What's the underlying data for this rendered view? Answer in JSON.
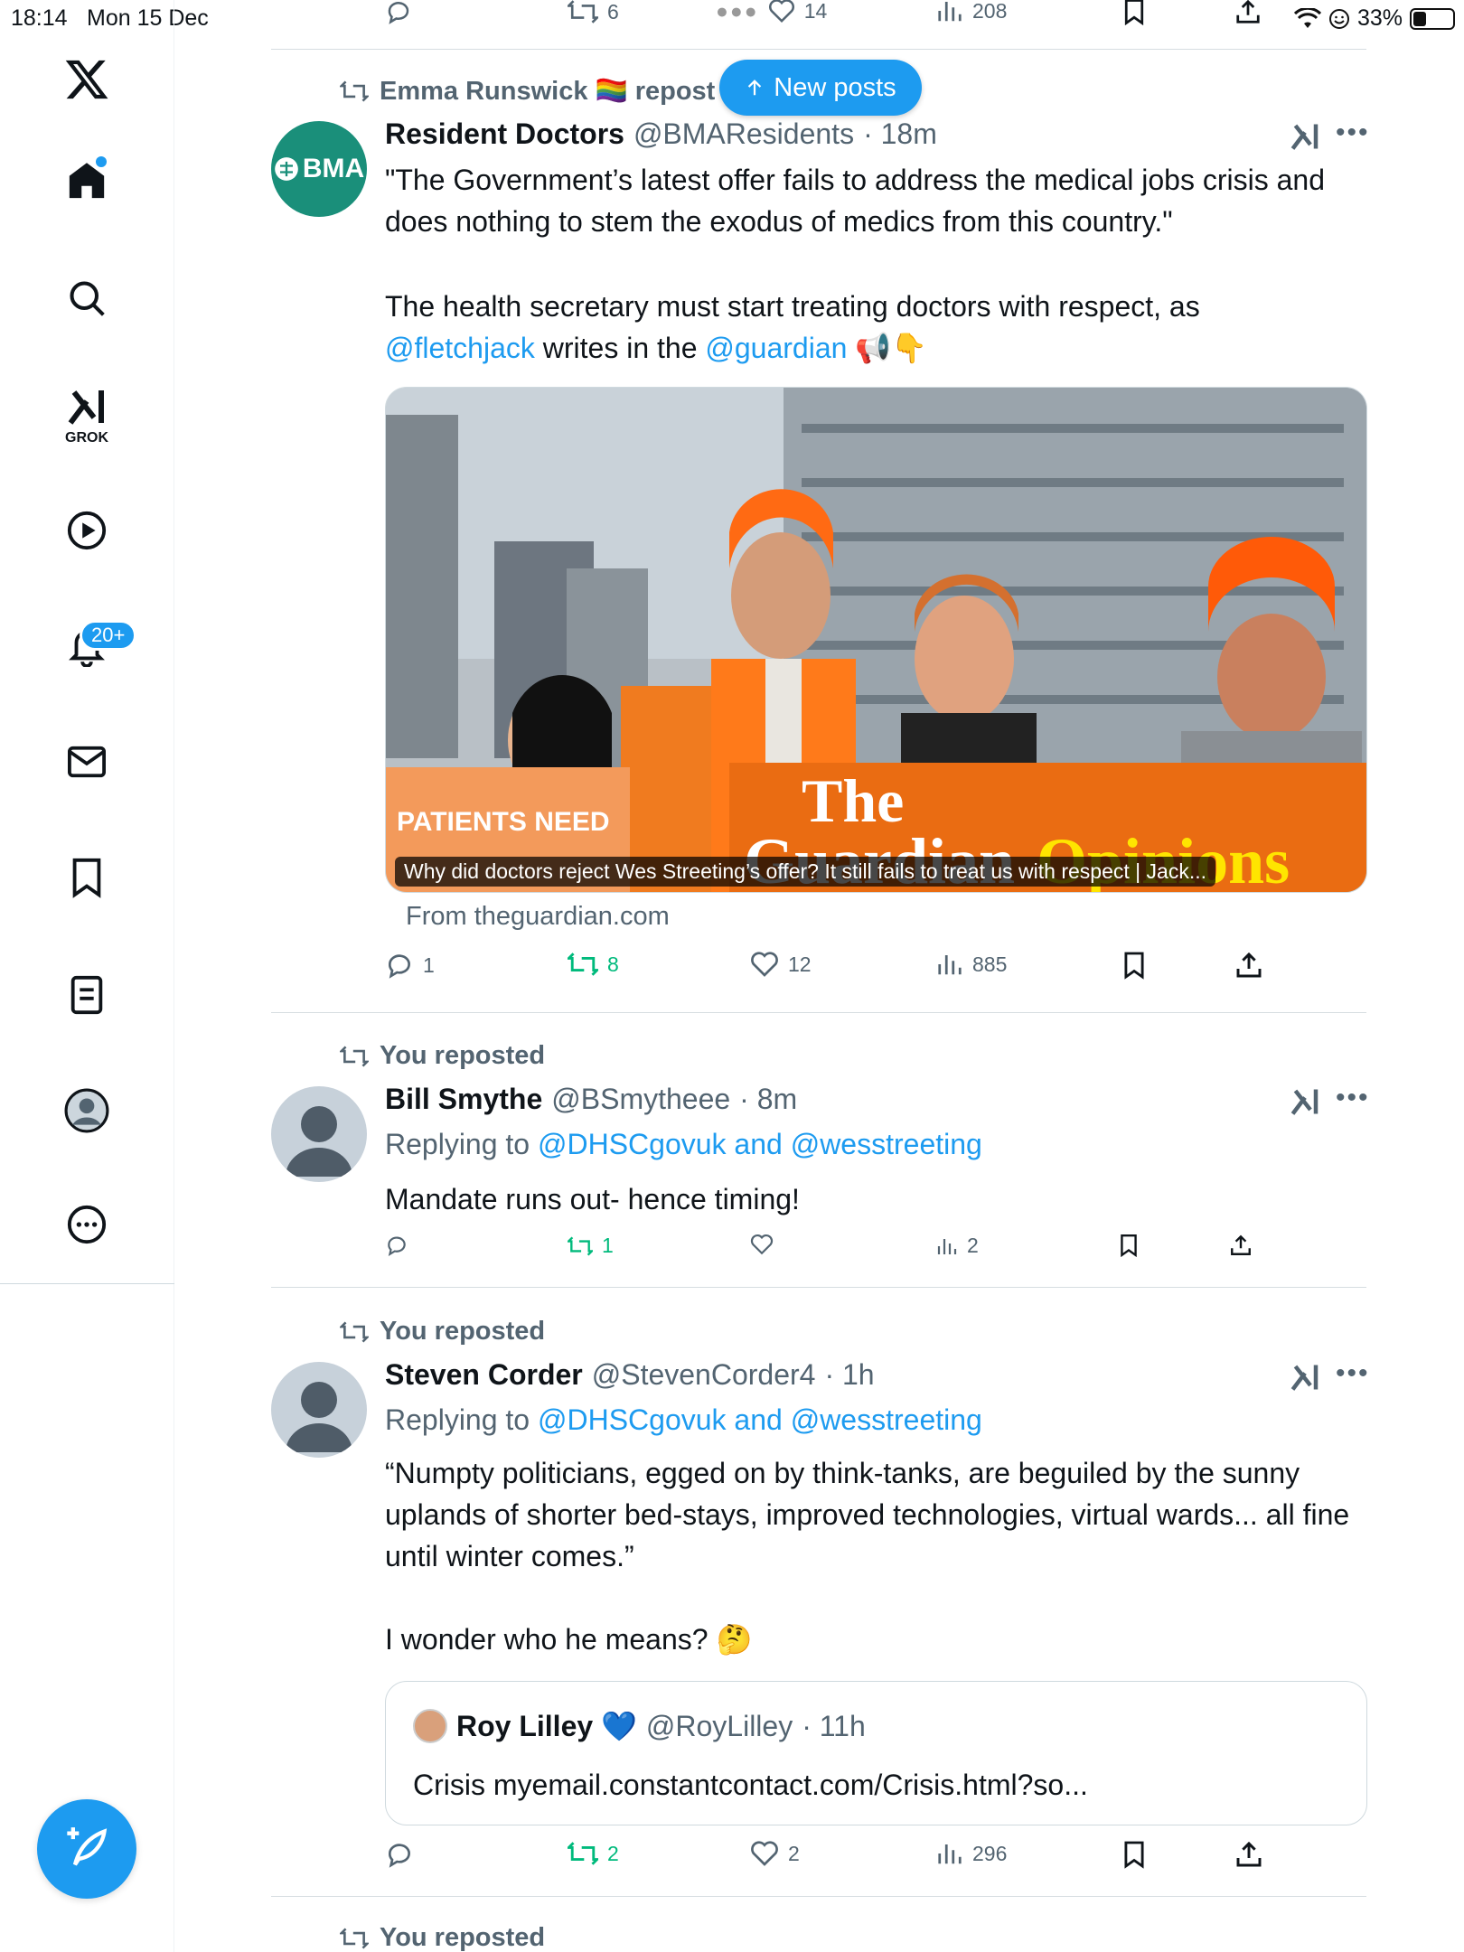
{
  "status_bar": {
    "time": "18:14",
    "date": "Mon 15 Dec",
    "battery": "33%"
  },
  "new_posts_label": "New posts",
  "notifications_badge": "20+",
  "grok_label": "GROK",
  "top_actions": {
    "reposts": "6",
    "likes": "14",
    "views": "208"
  },
  "posts": [
    {
      "repost_label": "Emma Runswick 🏳️‍🌈 repost",
      "name": "Resident Doctors",
      "handle": "@BMAResidents",
      "time": "· 18m",
      "avatar_text": "BMA",
      "text_1": "\"The Government’s latest offer fails to address the medical jobs crisis and does nothing to stem the exodus of medics from this country.\"",
      "text_2_a": "The health secretary must start treating doctors with respect, as ",
      "text_2_link1": "@fletchjack",
      "text_2_b": " writes in the ",
      "text_2_link2": "@guardian",
      "text_2_c": " 📢👇",
      "media_caption": "Why did doctors reject Wes Streeting’s offer? It still fails to treat us with respect | Jack...",
      "media_brand_1": "The",
      "media_brand_2": "Guardian",
      "media_brand_3": "Opinions",
      "media_sign_text": "PATIENTS NEED",
      "from": "From theguardian.com",
      "replies": "1",
      "reposts": "8",
      "likes": "12",
      "views": "885"
    },
    {
      "repost_label": "You reposted",
      "name": "Bill Smythe",
      "handle": "@BSmytheee",
      "time": "· 8m",
      "replying_prefix": "Replying to ",
      "replying_to": "@DHSCgovuk and @wesstreeting",
      "text": "Mandate runs out- hence timing!",
      "reposts": "1",
      "views": "2"
    },
    {
      "repost_label": "You reposted",
      "name": "Steven Corder",
      "handle": "@StevenCorder4",
      "time": "· 1h",
      "replying_prefix": "Replying to ",
      "replying_to": "@DHSCgovuk and @wesstreeting",
      "text": "“Numpty politicians, egged on by think-tanks, are beguiled by the sunny uplands of shorter bed-stays, improved technologies, virtual wards... all fine until winter comes.”\n\nI wonder who he means? 🤔",
      "quote": {
        "name": "Roy Lilley 💙",
        "handle": "@RoyLilley",
        "time": "· 11h",
        "text": "Crisis myemail.constantcontact.com/Crisis.html?so..."
      },
      "reposts": "2",
      "likes": "2",
      "views": "296"
    },
    {
      "repost_label": "You reposted"
    }
  ]
}
